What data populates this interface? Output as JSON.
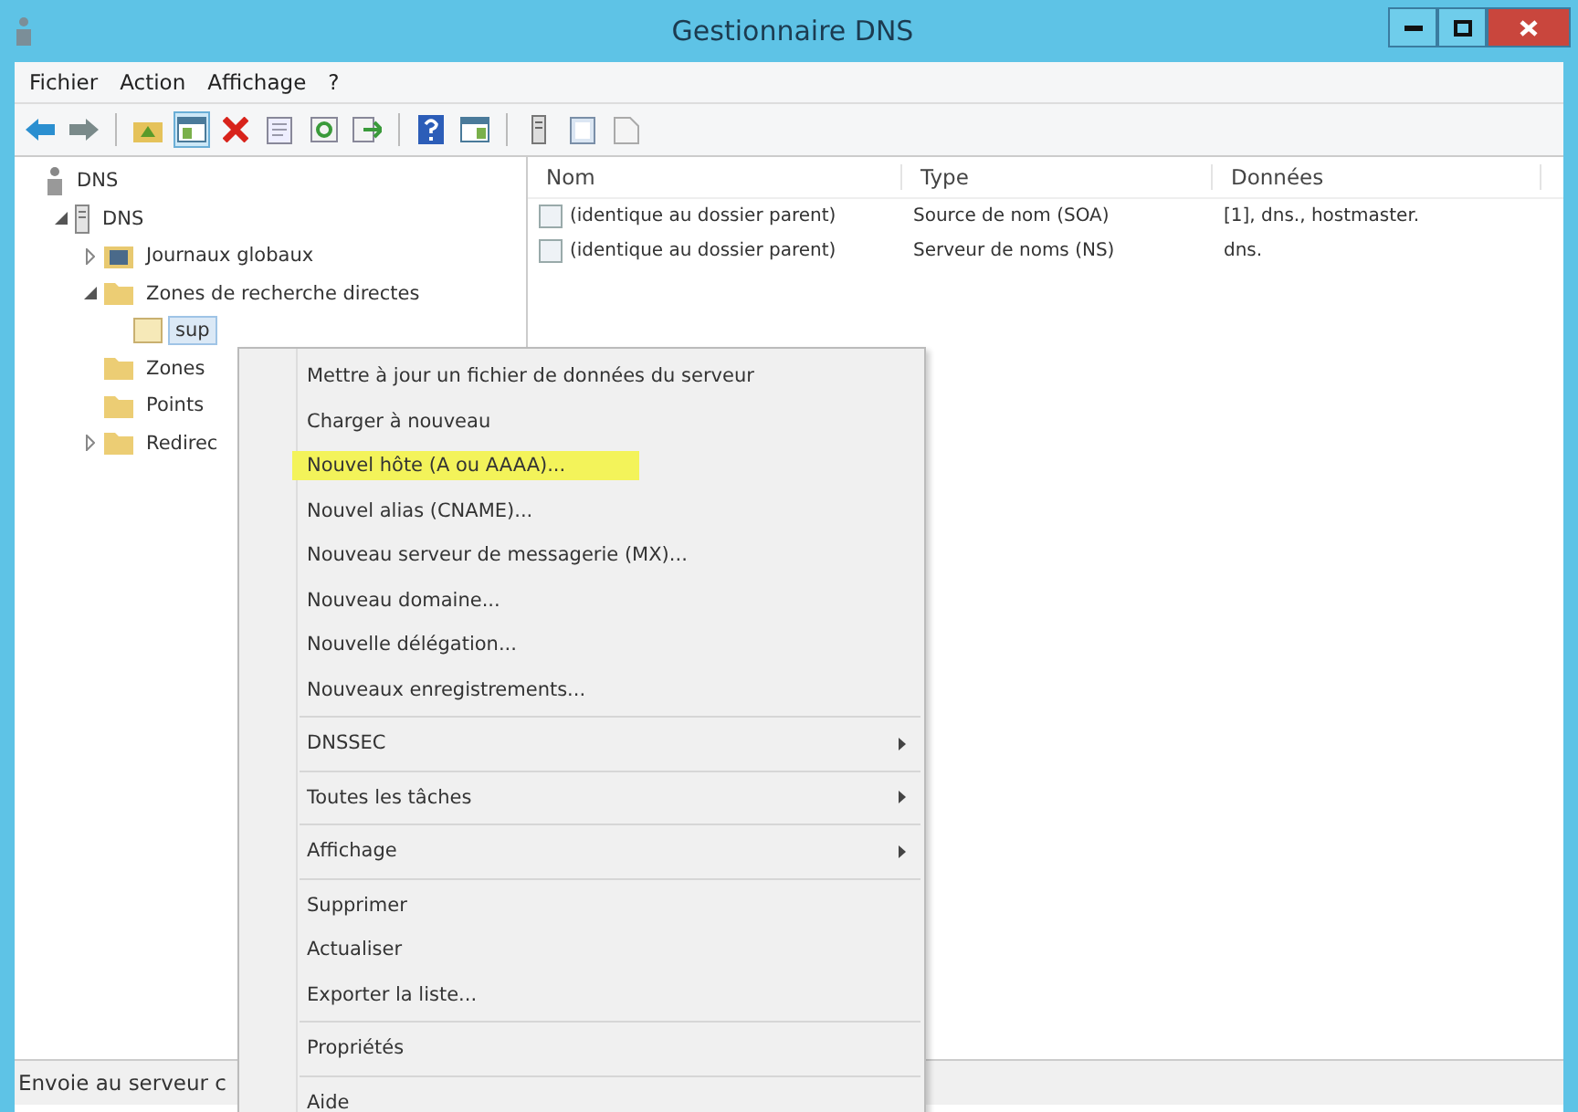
{
  "window": {
    "title": "Gestionnaire DNS"
  },
  "menu_bar": [
    "Fichier",
    "Action",
    "Affichage",
    "?"
  ],
  "toolbar": [
    {
      "kind": "back",
      "pressed": false
    },
    {
      "kind": "forward",
      "pressed": false
    },
    {
      "kind": "sep"
    },
    {
      "kind": "up",
      "pressed": false
    },
    {
      "kind": "tree",
      "pressed": true
    },
    {
      "kind": "delete",
      "pressed": false
    },
    {
      "kind": "properties",
      "pressed": false
    },
    {
      "kind": "refresh",
      "pressed": false
    },
    {
      "kind": "export",
      "pressed": false
    },
    {
      "kind": "sep"
    },
    {
      "kind": "help",
      "pressed": false
    },
    {
      "kind": "panel",
      "pressed": false
    },
    {
      "kind": "sep"
    },
    {
      "kind": "server",
      "pressed": false
    },
    {
      "kind": "list",
      "pressed": false
    },
    {
      "kind": "page",
      "pressed": false
    }
  ],
  "tree": [
    {
      "label": "DNS",
      "kind": "root",
      "selected": false,
      "children": [
        {
          "label": "DNS",
          "kind": "server",
          "expanded": true,
          "selected": false,
          "children": [
            {
              "label": "Journaux globaux",
              "kind": "logs",
              "expanded": false,
              "selected": false
            },
            {
              "label": "Zones de recherche directes",
              "kind": "folder",
              "expanded": true,
              "selected": false,
              "children": [
                {
                  "label": "sup",
                  "kind": "zone",
                  "selected": true
                }
              ]
            },
            {
              "label": "Zones",
              "kind": "folder",
              "selected": false
            },
            {
              "label": "Points",
              "kind": "folder",
              "selected": false
            },
            {
              "label": "Redirec",
              "kind": "folder",
              "expanded": false,
              "selected": false
            }
          ]
        }
      ]
    }
  ],
  "table": {
    "columns": [
      "Nom",
      "Type",
      "Données"
    ],
    "rows": [
      [
        "(identique au dossier parent)",
        "Source de nom (SOA)",
        "[1], dns., hostmaster."
      ],
      [
        "(identique au dossier parent)",
        "Serveur de noms (NS)",
        "dns."
      ]
    ]
  },
  "context_menu": [
    {
      "kind": "item",
      "label": "Mettre à jour un fichier de données du serveur",
      "highlighted": false
    },
    {
      "kind": "item",
      "label": "Charger à nouveau",
      "highlighted": false
    },
    {
      "kind": "item",
      "label": "Nouvel hôte (A ou AAAA)...",
      "highlighted": true
    },
    {
      "kind": "item",
      "label": "Nouvel alias (CNAME)...",
      "highlighted": false
    },
    {
      "kind": "item",
      "label": "Nouveau serveur de messagerie (MX)...",
      "highlighted": false
    },
    {
      "kind": "item",
      "label": "Nouveau domaine...",
      "highlighted": false
    },
    {
      "kind": "item",
      "label": "Nouvelle délégation...",
      "highlighted": false
    },
    {
      "kind": "item",
      "label": "Nouveaux enregistrements...",
      "highlighted": false
    },
    {
      "kind": "separator"
    },
    {
      "kind": "submenu",
      "label": "DNSSEC",
      "highlighted": false
    },
    {
      "kind": "separator"
    },
    {
      "kind": "submenu",
      "label": "Toutes les tâches",
      "highlighted": false
    },
    {
      "kind": "separator"
    },
    {
      "kind": "submenu",
      "label": "Affichage",
      "highlighted": false
    },
    {
      "kind": "separator"
    },
    {
      "kind": "item",
      "label": "Supprimer",
      "highlighted": false
    },
    {
      "kind": "item",
      "label": "Actualiser",
      "highlighted": false
    },
    {
      "kind": "item",
      "label": "Exporter la liste...",
      "highlighted": false
    },
    {
      "kind": "separator"
    },
    {
      "kind": "item",
      "label": "Propriétés",
      "highlighted": false
    },
    {
      "kind": "separator"
    },
    {
      "kind": "item",
      "label": "Aide",
      "highlighted": false
    }
  ],
  "status_bar": "Envoie au serveur c"
}
